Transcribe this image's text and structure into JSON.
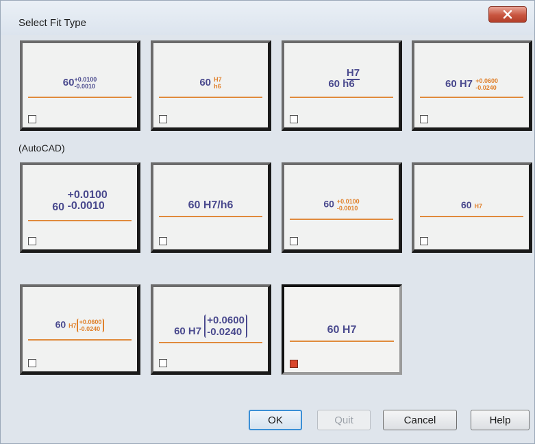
{
  "dialog": {
    "title": "Select Fit Type",
    "section_label": "(AutoCAD)"
  },
  "tiles": [
    {
      "base": "60",
      "tol_upper": "+0.0100",
      "tol_lower": "-0.0010",
      "checked": false
    },
    {
      "base": "60",
      "hole": "H7",
      "shaft": "h6",
      "checked": false
    },
    {
      "base": "60",
      "hole": "H7",
      "shaft": "h6",
      "checked": false
    },
    {
      "base": "60 H7",
      "tol_upper": "+0.0600",
      "tol_lower": "-0.0240",
      "checked": false
    },
    {
      "base": "60",
      "tol_upper": "+0.0100",
      "tol_lower": "-0.0010",
      "checked": false
    },
    {
      "text": "60 H7/h6",
      "checked": false
    },
    {
      "base": "60",
      "tol_upper": "+0.0100",
      "tol_lower": "-0.0010",
      "checked": false
    },
    {
      "base": "60",
      "hole": "H7",
      "checked": false
    },
    {
      "base": "60",
      "hole": "H7",
      "tol_upper": "+0.0600",
      "tol_lower": "-0.0240",
      "checked": false
    },
    {
      "base": "60 H7",
      "tol_upper": "+0.0600",
      "tol_lower": "-0.0240",
      "checked": false
    },
    {
      "text": "60 H7",
      "checked": true
    }
  ],
  "buttons": {
    "ok": "OK",
    "quit": "Quit",
    "cancel": "Cancel",
    "help": "Help"
  }
}
